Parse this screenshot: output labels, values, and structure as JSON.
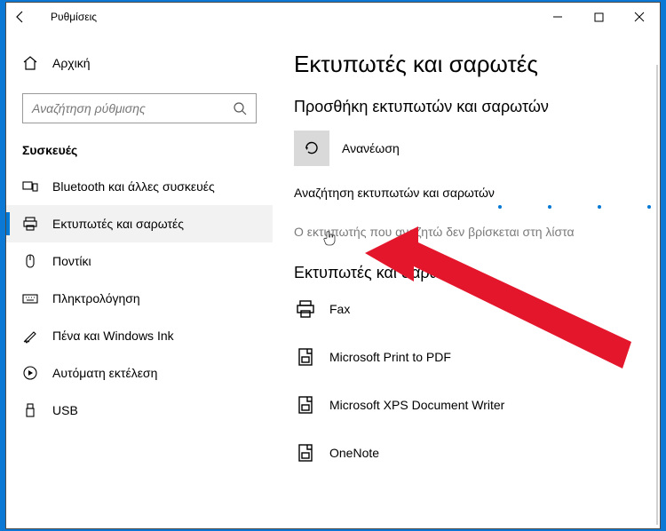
{
  "window": {
    "title": "Ρυθμίσεις"
  },
  "sidebar": {
    "home_label": "Αρχική",
    "search_placeholder": "Αναζήτηση ρύθμισης",
    "category": "Συσκευές",
    "items": [
      {
        "label": "Bluetooth και άλλες συσκευές"
      },
      {
        "label": "Εκτυπωτές και σαρωτές"
      },
      {
        "label": "Ποντίκι"
      },
      {
        "label": "Πληκτρολόγηση"
      },
      {
        "label": "Πένα και Windows Ink"
      },
      {
        "label": "Αυτόματη εκτέλεση"
      },
      {
        "label": "USB"
      }
    ]
  },
  "main": {
    "title": "Εκτυπωτές και σαρωτές",
    "add_section": "Προσθήκη εκτυπωτών και σαρωτών",
    "refresh_label": "Ανανέωση",
    "searching_status": "Αναζήτηση εκτυπωτών και σαρωτών",
    "missing_link": "Ο εκτυπωτής που αναζητώ δεν βρίσκεται στη λίστα",
    "list_section": "Εκτυπωτές και σαρωτές",
    "printers": [
      {
        "label": "Fax"
      },
      {
        "label": "Microsoft Print to PDF"
      },
      {
        "label": "Microsoft XPS Document Writer"
      },
      {
        "label": "OneNote"
      }
    ]
  }
}
